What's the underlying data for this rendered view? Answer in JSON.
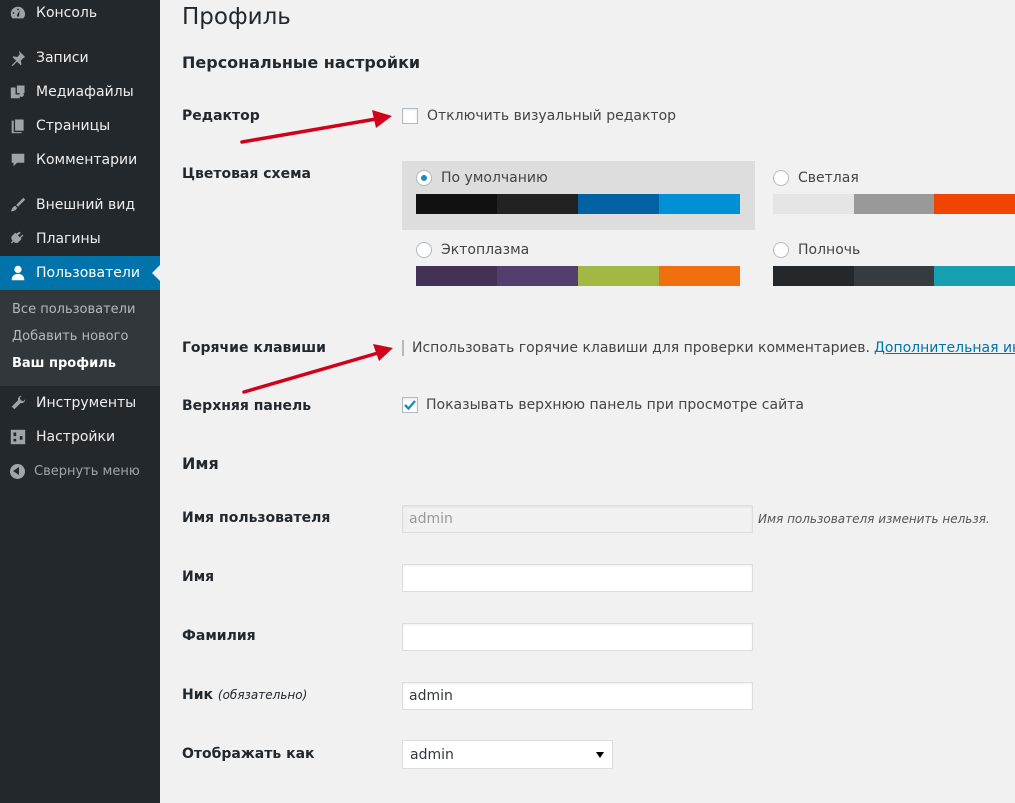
{
  "sidebar": {
    "items": [
      {
        "label": "Консоль",
        "icon": "dashboard-icon"
      },
      {
        "label": "Записи",
        "icon": "pin-icon"
      },
      {
        "label": "Медиафайлы",
        "icon": "media-icon"
      },
      {
        "label": "Страницы",
        "icon": "pages-icon"
      },
      {
        "label": "Комментарии",
        "icon": "comment-icon"
      },
      {
        "label": "Внешний вид",
        "icon": "brush-icon"
      },
      {
        "label": "Плагины",
        "icon": "plug-icon"
      },
      {
        "label": "Пользователи",
        "icon": "user-icon"
      },
      {
        "label": "Инструменты",
        "icon": "wrench-icon"
      },
      {
        "label": "Настройки",
        "icon": "settings-icon"
      }
    ],
    "submenu": [
      "Все пользователи",
      "Добавить нового",
      "Ваш профиль"
    ],
    "collapse_label": "Свернуть меню"
  },
  "page": {
    "title": "Профиль",
    "personal_heading": "Персональные настройки",
    "editor": {
      "label": "Редактор",
      "checkbox_text": "Отключить визуальный редактор",
      "checked": false
    },
    "color_scheme": {
      "label": "Цветовая схема",
      "schemes": [
        {
          "name": "По умолчанию",
          "selected": true,
          "colors": [
            "#111111",
            "#222222",
            "#0062a3",
            "#0090d6"
          ]
        },
        {
          "name": "Светлая",
          "selected": false,
          "colors": [
            "#e5e5e5",
            "#999999",
            "#f04500",
            "#f04500"
          ]
        },
        {
          "name": "Эктоплазма",
          "selected": false,
          "colors": [
            "#413256",
            "#523f6d",
            "#a3b745",
            "#f0700f"
          ]
        },
        {
          "name": "Полночь",
          "selected": false,
          "colors": [
            "#25282b",
            "#363b3f",
            "#159fb1",
            "#159fb1"
          ]
        }
      ]
    },
    "hotkeys": {
      "label": "Горячие клавиши",
      "checkbox_text": "Использовать горячие клавиши для проверки комментариев.",
      "link_text": "Дополнительная инфор",
      "checked": false
    },
    "toolbar": {
      "label": "Верхняя панель",
      "checkbox_text": "Показывать верхнюю панель при просмотре сайта",
      "checked": true
    },
    "name_heading": "Имя",
    "username": {
      "label": "Имя пользователя",
      "value": "admin",
      "hint": "Имя пользователя изменить нельзя."
    },
    "first_name": {
      "label": "Имя",
      "value": ""
    },
    "last_name": {
      "label": "Фамилия",
      "value": ""
    },
    "nickname": {
      "label": "Ник",
      "required": "(обязательно)",
      "value": "admin"
    },
    "display_as": {
      "label": "Отображать как",
      "value": "admin"
    }
  },
  "colors": {
    "sidebar_bg": "#23282d",
    "accent": "#0073aa",
    "annotation_arrow": "#d0021b"
  }
}
